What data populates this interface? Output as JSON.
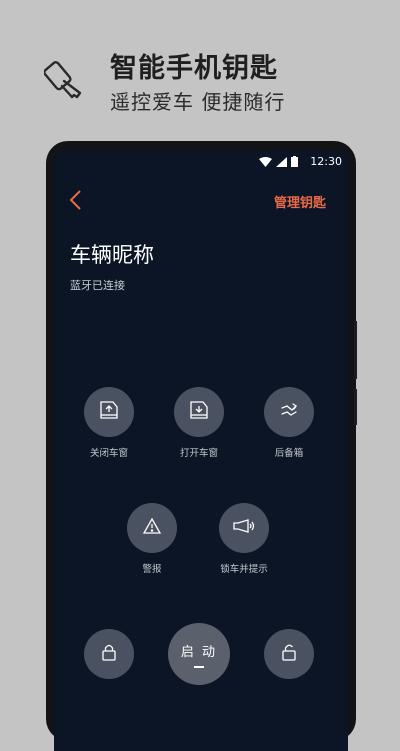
{
  "promo": {
    "title": "智能手机钥匙",
    "subtitle": "遥控爱车  便捷随行",
    "icon": "car-key-icon"
  },
  "status_bar": {
    "time": "12:30",
    "icons": [
      "wifi-icon",
      "signal-icon",
      "battery-icon"
    ]
  },
  "header": {
    "back_icon": "chevron-left-icon",
    "manage_label": "管理钥匙"
  },
  "vehicle": {
    "name": "车辆昵称",
    "connection": "蓝牙已连接"
  },
  "controls": [
    {
      "label": "关闭车窗",
      "icon": "window-close-icon"
    },
    {
      "label": "打开车窗",
      "icon": "window-open-icon"
    },
    {
      "label": "后备箱",
      "icon": "trunk-icon"
    },
    {
      "label": "警报",
      "icon": "warning-icon"
    },
    {
      "label": "锁车并提示",
      "icon": "horn-icon"
    }
  ],
  "bottom_controls": {
    "lock_icon": "lock-icon",
    "start_label": "启 动",
    "unlock_icon": "unlock-icon"
  },
  "colors": {
    "accent": "#e86a47",
    "screen_bg": "#0c1526",
    "button_bg": "#4a5160",
    "page_bg": "#c4c4c4"
  }
}
